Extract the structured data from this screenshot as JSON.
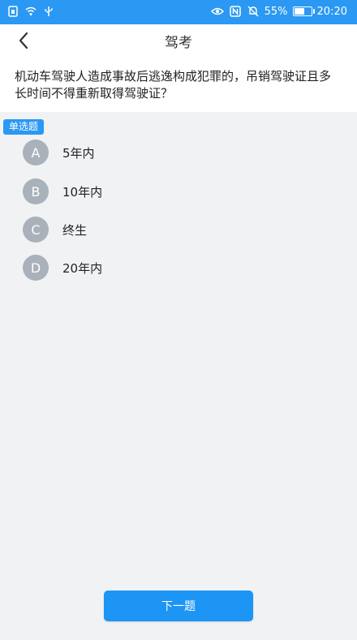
{
  "status_bar": {
    "battery_percent": "55%",
    "time": "20:20"
  },
  "header": {
    "title": "驾考",
    "back_icon": "chevron-left-icon"
  },
  "question": {
    "text": "机动车驾驶人造成事故后逃逸构成犯罪的，吊销驾驶证且多长时间不得重新取得驾驶证？",
    "type_label": "单选题"
  },
  "options": [
    {
      "letter": "A",
      "text": "5年内"
    },
    {
      "letter": "B",
      "text": "10年内"
    },
    {
      "letter": "C",
      "text": "终生"
    },
    {
      "letter": "D",
      "text": "20年内"
    }
  ],
  "footer": {
    "next_label": "下一题"
  },
  "colors": {
    "accent": "#2b98f3",
    "option_circle": "#a9b1bb",
    "background": "#f1f2f4"
  }
}
